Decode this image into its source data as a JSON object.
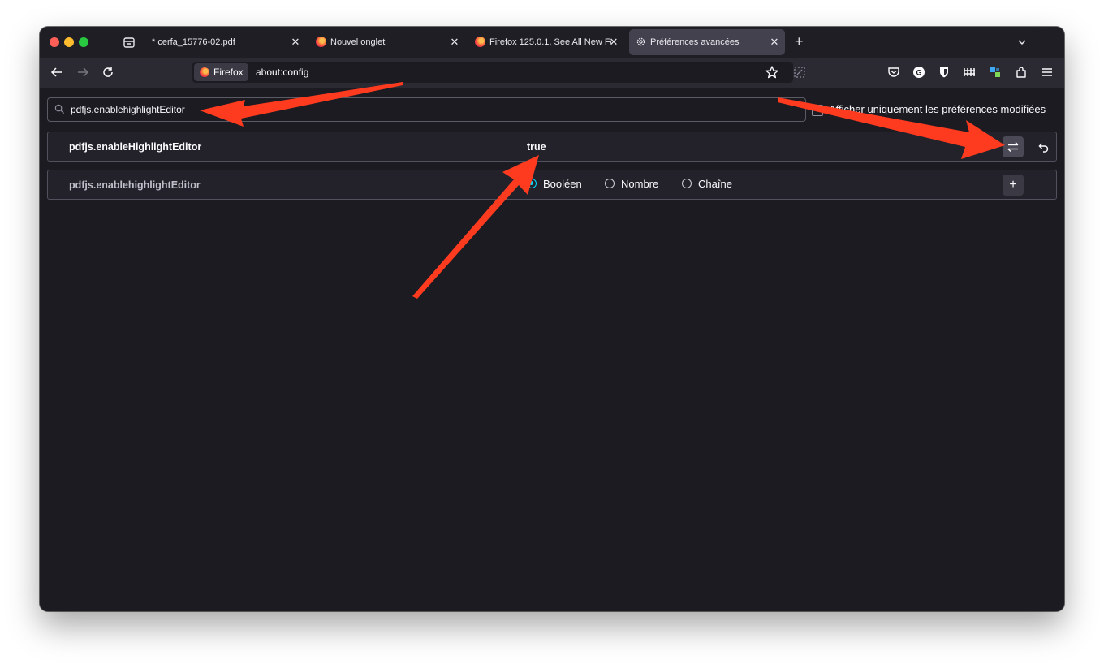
{
  "tabs": [
    {
      "title": "* cerfa_15776-02.pdf",
      "icon": "pdf-document-icon",
      "active": false
    },
    {
      "title": "Nouvel onglet",
      "icon": "firefox-icon",
      "active": false
    },
    {
      "title": "Firefox 125.0.1, See All New Fea",
      "icon": "firefox-icon",
      "active": false
    },
    {
      "title": "Préférences avancées",
      "icon": "gear-icon",
      "active": true
    }
  ],
  "navbar": {
    "identity_label": "Firefox",
    "url": "about:config"
  },
  "config": {
    "search_value": "pdfjs.enablehighlightEditor",
    "show_modified_label": "Afficher uniquement les préférences modifiées",
    "existing_pref": {
      "name": "pdfjs.enableHighlightEditor",
      "value": "true"
    },
    "new_pref": {
      "name": "pdfjs.enablehighlightEditor",
      "types": [
        "Booléen",
        "Nombre",
        "Chaîne"
      ],
      "selected_type": "Booléen",
      "add_label": "+"
    }
  },
  "colors": {
    "background": "#1c1b22",
    "accent": "#00ddff",
    "annotation_arrow": "#ff3b1f"
  }
}
